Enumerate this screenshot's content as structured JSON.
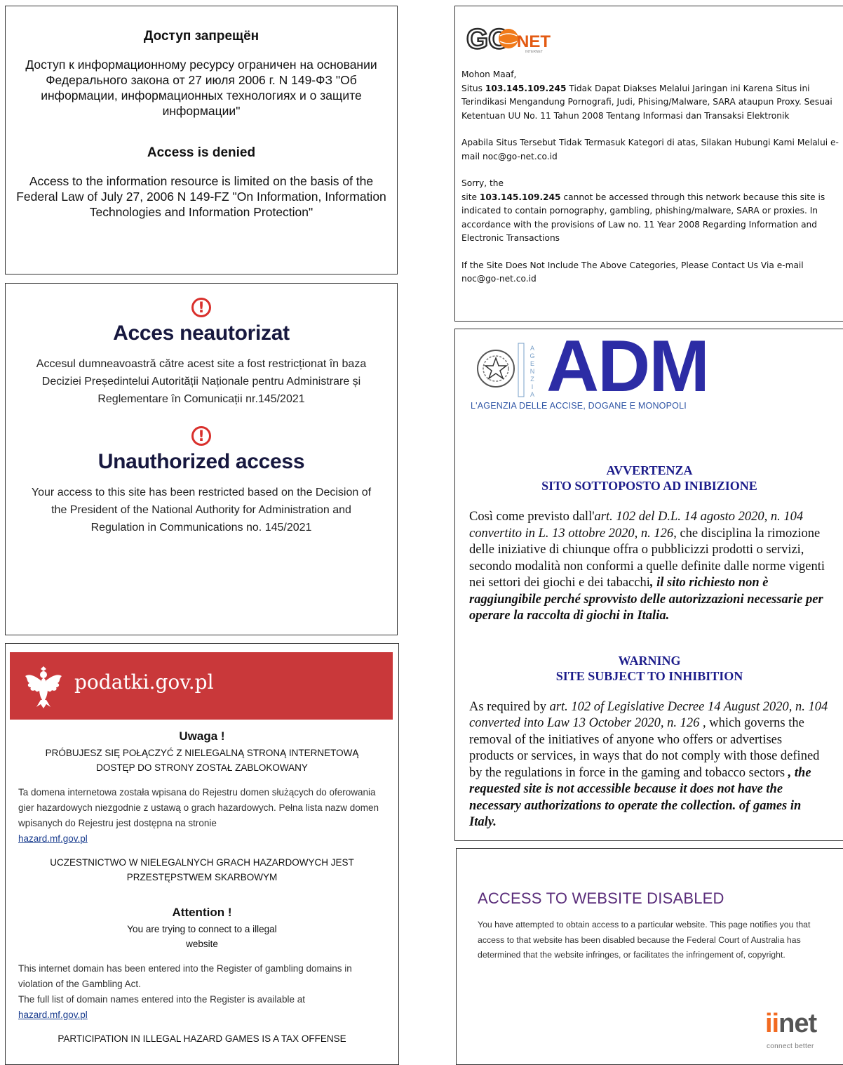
{
  "russia": {
    "title_ru": "Доступ запрещён",
    "text_ru": "Доступ к информационному ресурсу ограничен на основании Федерального закона от 27 июля 2006 г. N 149-ФЗ \"Об информации, информационных технологиях и о защите информации\"",
    "title_en": "Access is denied",
    "text_en": "Access to the information resource is limited on the basis of the Federal Law of July 27, 2006 N 149-FZ \"On Information, Information Technologies and Information Protection\""
  },
  "romania": {
    "title_ro": "Acces neautorizat",
    "text_ro": "Accesul dumneavoastră către acest site a fost restricționat în baza Deciziei Președintelui Autorității Naționale pentru Administrare și Reglementare în Comunicații nr.145/2021",
    "title_en": "Unauthorized access",
    "text_en": "Your access to this site has been restricted based on the Decision of the President of the National Authority for Administration and Regulation in Communications no. 145/2021",
    "icon": "exclamation-circle-icon",
    "accent": "#d9302c",
    "title_color": "#17183f"
  },
  "poland": {
    "site": "podatki.gov.pl",
    "banner_color": "#c9383a",
    "pl_heading": "Uwaga !",
    "pl_caps1": "PRÓBUJESZ SIĘ POŁĄCZYĆ Z NIELEGALNĄ STRONĄ INTERNETOWĄ",
    "pl_caps2": "DOSTĘP DO STRONY ZOSTAŁ ZABLOKOWANY",
    "pl_para": "Ta domena internetowa została wpisana do Rejestru domen służących do oferowania gier hazardowych niezgodnie z ustawą o grach hazardowych. Pełna lista nazw domen wpisanych do Rejestru jest dostępna na stronie",
    "link": "hazard.mf.gov.pl",
    "pl_caps3": "UCZESTNICTWO W NIELEGALNYCH GRACH HAZARDOWYCH JEST PRZESTĘPSTWEM SKARBOWYM",
    "en_heading": "Attention !",
    "en_sub1": "You are trying to connect to a illegal",
    "en_sub2": "website",
    "en_para1": "This internet domain has been entered into the Register of gambling domains in violation of the Gambling Act.",
    "en_para2": "The full list of domain names entered into the Register is available at",
    "en_caps": "PARTICIPATION IN ILLEGAL HAZARD GAMES IS A TAX OFFENSE"
  },
  "indonesia": {
    "logo_go": "GO",
    "logo_net": "NET",
    "logo_tag": "INTERNET",
    "p1_a": "Mohon Maaf,",
    "p1_b": "Situs ",
    "ip": "103.145.109.245",
    "p1_c": " Tidak Dapat Diakses Melalui Jaringan ini Karena Situs ini Terindikasi Mengandung Pornografi, Judi, Phising/Malware, SARA ataupun Proxy. Sesuai Ketentuan UU No. 11 Tahun 2008 Tentang Informasi dan Transaksi Elektronik",
    "p2": "Apabila Situs Tersebut Tidak Termasuk Kategori di atas, Silakan Hubungi Kami Melalui e-mail noc@go-net.co.id",
    "p3_a": "Sorry, the",
    "p3_b": "site ",
    "p3_c": " cannot be accessed through this network because this site is indicated to contain pornography, gambling, phishing/malware, SARA or proxies. In accordance with the provisions of Law no. 11 Year 2008 Regarding Information and Electronic Transactions",
    "p4": "If the Site Does Not Include The Above Categories, Please Contact Us Via e-mail noc@go-net.co.id"
  },
  "italy": {
    "logo": "ADM",
    "agency": "L'AGENZIA DELLE ACCISE, DOGANE E MONOPOLI",
    "vertical": "AGENZIA",
    "it_h1": "AVVERTENZA",
    "it_h2": "SITO SOTTOPOSTO AD INIBIZIONE",
    "it_a": "Così come previsto dall'",
    "it_b": "art. 102 del D.L. 14 agosto 2020, n. 104 convertito in L. 13 ottobre 2020, n. 126",
    "it_c": ", che disciplina la rimozione delle iniziative di chiunque offra o pubblicizzi prodotti o servizi, secondo modalità non conformi a quelle definite dalle norme vigenti nei settori dei giochi e dei tabacchi",
    "it_d": ", il sito richiesto non è raggiungibile perché sprovvisto delle autorizzazioni necessarie per operare la raccolta di giochi in Italia.",
    "en_h1": "WARNING",
    "en_h2": "SITE SUBJECT TO INHIBITION",
    "en_a": "As required by ",
    "en_b": "art. 102 of Legislative Decree 14 August 2020, n. 104 converted into Law 13 October 2020, n. 126",
    "en_c": " , which governs the removal of the initiatives of anyone who offers or advertises products or services, in ways that do not comply with those defined by the regulations in force in the gaming and tobacco sectors",
    "en_d": " , the requested site is not accessible because it does not have the necessary authorizations to operate the collection. of games in Italy."
  },
  "australia": {
    "title": "ACCESS TO WEBSITE DISABLED",
    "text": "You have attempted to obtain access to a particular website. This page notifies you that access to that website has been disabled because the Federal Court of Australia has determined that the website infringes, or facilitates the infringement of, copyright.",
    "logo_ii": "ii",
    "logo_net": "net",
    "tagline": "connect better"
  }
}
